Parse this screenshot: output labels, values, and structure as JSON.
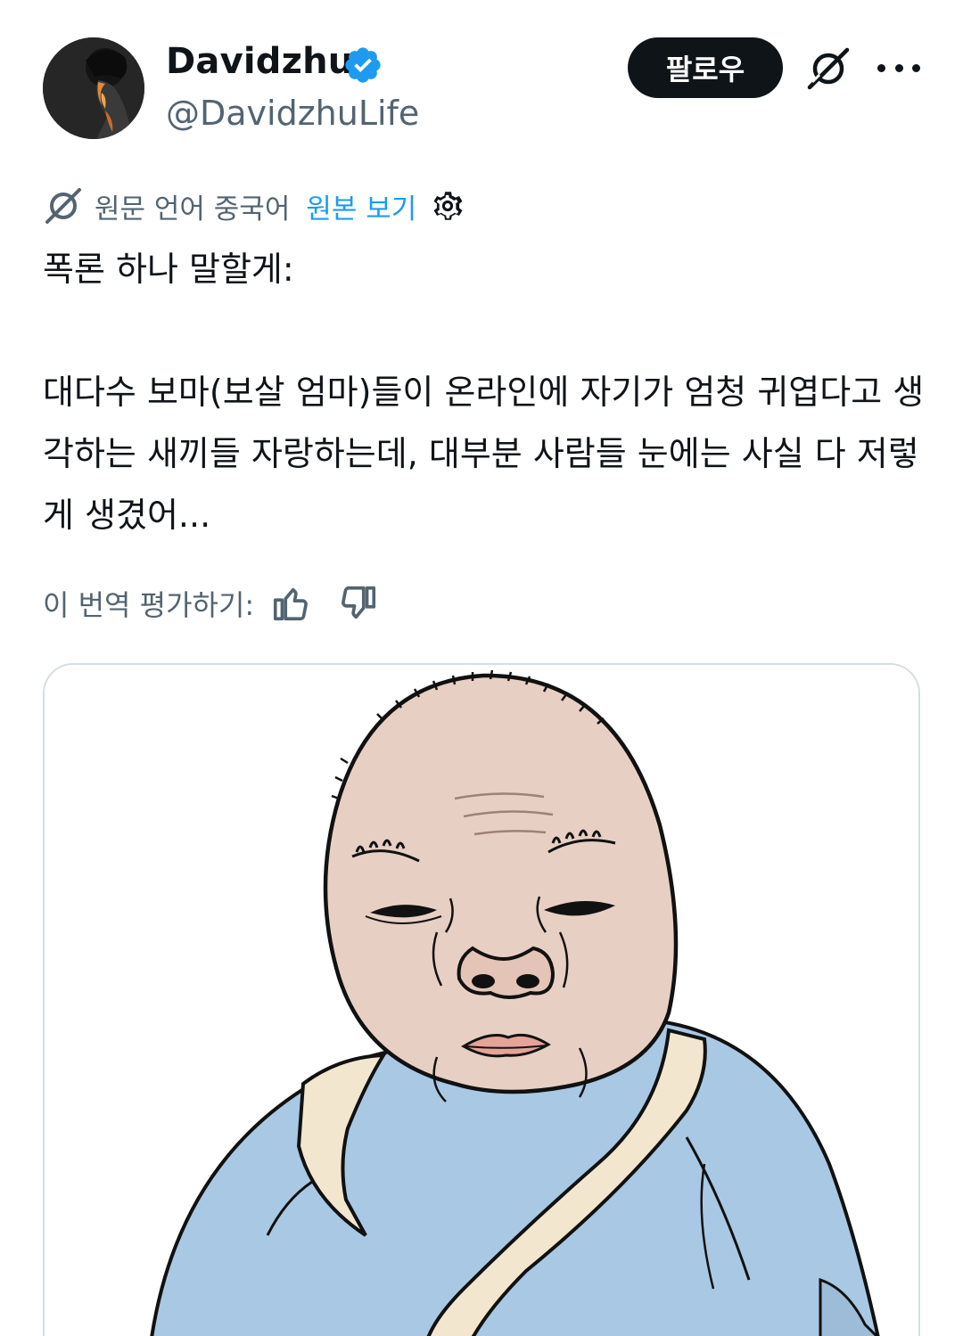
{
  "user": {
    "display_name": "Davidzhu",
    "handle": "@DavidzhuLife",
    "verified": true,
    "avatar_icon": "profile-photo"
  },
  "actions": {
    "follow_label": "팔로우",
    "grok_icon": "grok-icon",
    "more_icon": "more-icon"
  },
  "translation": {
    "note": "원문 언어 중국어",
    "show_original": "원본 보기",
    "settings_icon": "gear-icon"
  },
  "tweet": {
    "text": "폭론 하나 말할게:\n\n대다수 보마(보살 엄마)들이 온라인에 자기가 엄청 귀엽다고 생각하는 새끼들 자랑하는데, 대부분 사람들 눈에는 사실 다 저렇게 생겼어..."
  },
  "rating": {
    "label": "이 번역 평가하기:",
    "thumbs_up_icon": "thumbs-up-icon",
    "thumbs_down_icon": "thumbs-down-icon"
  },
  "media": {
    "type": "illustration",
    "subject": "cartoon-baby-in-blue-swaddle"
  },
  "colors": {
    "text": "#0f1419",
    "secondary": "#536471",
    "link": "#1d9bf0",
    "verified": "#1d9bf0",
    "follow_bg": "#0f1419",
    "skin": "#e8cfc4",
    "swaddle": "#a9c8e4"
  }
}
